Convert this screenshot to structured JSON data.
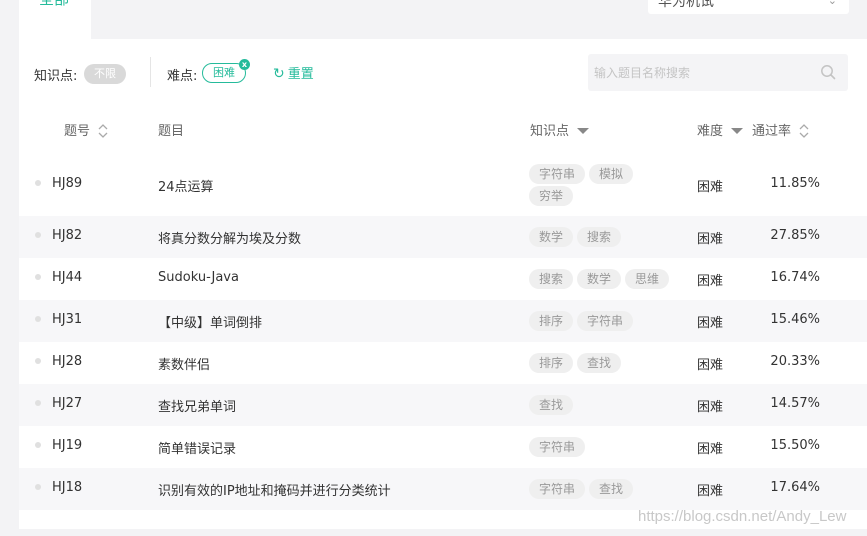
{
  "top": {
    "tab_label": "全部",
    "select_label": "华为机试"
  },
  "filters": {
    "knowledge_label": "知识点:",
    "knowledge_value": "不限",
    "difficulty_label": "难点:",
    "difficulty_value": "困难",
    "difficulty_clear": "x",
    "reset_label": "重置"
  },
  "search": {
    "placeholder": "输入题目名称搜索",
    "value": ""
  },
  "table": {
    "headers": {
      "id": "题号",
      "title": "题目",
      "knowledge": "知识点",
      "difficulty": "难度",
      "pass_rate": "通过率"
    },
    "rows": [
      {
        "id": "HJ89",
        "title": "24点运算",
        "tags": [
          "字符串",
          "模拟",
          "穷举"
        ],
        "difficulty": "困难",
        "rate": "11.85%"
      },
      {
        "id": "HJ82",
        "title": "将真分数分解为埃及分数",
        "tags": [
          "数学",
          "搜索"
        ],
        "difficulty": "困难",
        "rate": "27.85%"
      },
      {
        "id": "HJ44",
        "title": "Sudoku-Java",
        "tags": [
          "搜索",
          "数学",
          "思维"
        ],
        "difficulty": "困难",
        "rate": "16.74%"
      },
      {
        "id": "HJ31",
        "title": "【中级】单词倒排",
        "tags": [
          "排序",
          "字符串"
        ],
        "difficulty": "困难",
        "rate": "15.46%"
      },
      {
        "id": "HJ28",
        "title": "素数伴侣",
        "tags": [
          "排序",
          "查找"
        ],
        "difficulty": "困难",
        "rate": "20.33%"
      },
      {
        "id": "HJ27",
        "title": "查找兄弟单词",
        "tags": [
          "查找"
        ],
        "difficulty": "困难",
        "rate": "14.57%"
      },
      {
        "id": "HJ19",
        "title": "简单错误记录",
        "tags": [
          "字符串"
        ],
        "difficulty": "困难",
        "rate": "15.50%"
      },
      {
        "id": "HJ18",
        "title": "识别有效的IP地址和掩码并进行分类统计",
        "tags": [
          "字符串",
          "查找"
        ],
        "difficulty": "困难",
        "rate": "17.64%"
      }
    ]
  },
  "watermark": "https://blog.csdn.net/Andy_Lew",
  "colors": {
    "accent": "#25bb9b",
    "tag_bg": "#efefef",
    "tag_text": "#999999",
    "page_bg": "#f3f3f5"
  },
  "icons": {
    "search": "search-icon",
    "reset": "refresh-icon",
    "sort": "sort-arrows-icon",
    "filter": "filter-caret-icon",
    "clear": "close-icon"
  }
}
